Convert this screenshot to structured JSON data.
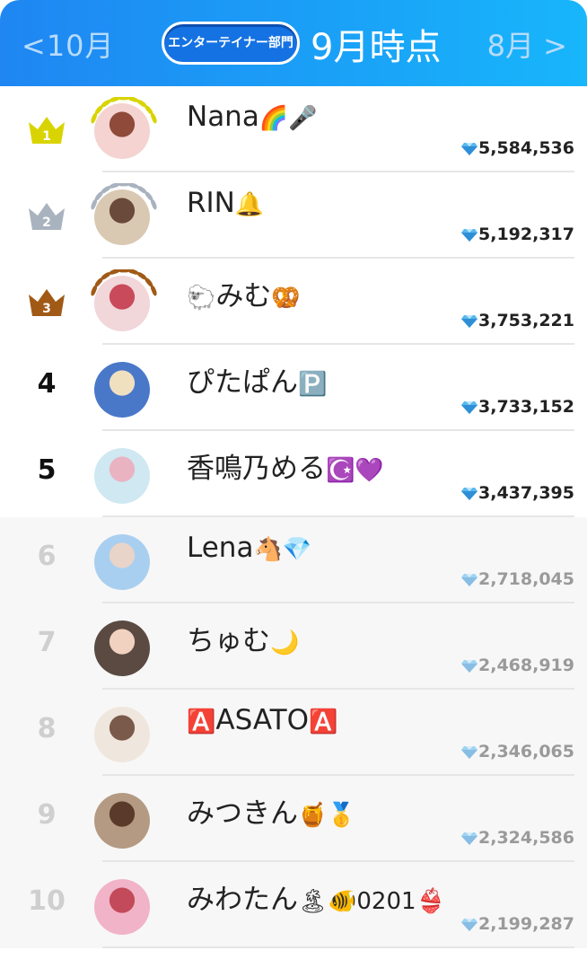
{
  "header": {
    "prev_label": "<10月",
    "category_label": "エンターテイナー部門",
    "period_label": "9月時点",
    "next_label": "8月 >"
  },
  "colors": {
    "header_start": "#1f86f2",
    "header_end": "#18b6fb",
    "gold": "#d9d400",
    "silver": "#a9b3bf",
    "bronze": "#a05a16",
    "dim_text": "#cfcfcf"
  },
  "ranking": [
    {
      "rank": "1",
      "name": "Nana",
      "emoji": "🌈🎤",
      "score": "5,584,536",
      "crown": "gold"
    },
    {
      "rank": "2",
      "name": "RIN",
      "emoji": "🔔",
      "score": "5,192,317",
      "crown": "silver"
    },
    {
      "rank": "3",
      "name": "みむ",
      "emoji": "🥨",
      "prefix_emoji": "🐑",
      "score": "3,753,221",
      "crown": "bronze"
    },
    {
      "rank": "4",
      "name": "ぴたぱん",
      "emoji": "🅿️",
      "score": "3,733,152"
    },
    {
      "rank": "5",
      "name": "香鳴乃める",
      "emoji": "☪️💜",
      "score": "3,437,395"
    },
    {
      "rank": "6",
      "name": "Lena",
      "emoji": "🐴💎",
      "score": "2,718,045"
    },
    {
      "rank": "7",
      "name": "ちゅむ",
      "emoji": "🌙",
      "score": "2,468,919"
    },
    {
      "rank": "8",
      "name": "ASATO",
      "emoji": "🅰️",
      "prefix_emoji": "🅰️",
      "score": "2,346,065"
    },
    {
      "rank": "9",
      "name": "みつきん",
      "emoji": "🍯🥇",
      "score": "2,324,586"
    },
    {
      "rank": "10",
      "name": "みわたん",
      "emoji": "🏝🐠0201👙",
      "score": "2,199,287"
    }
  ]
}
